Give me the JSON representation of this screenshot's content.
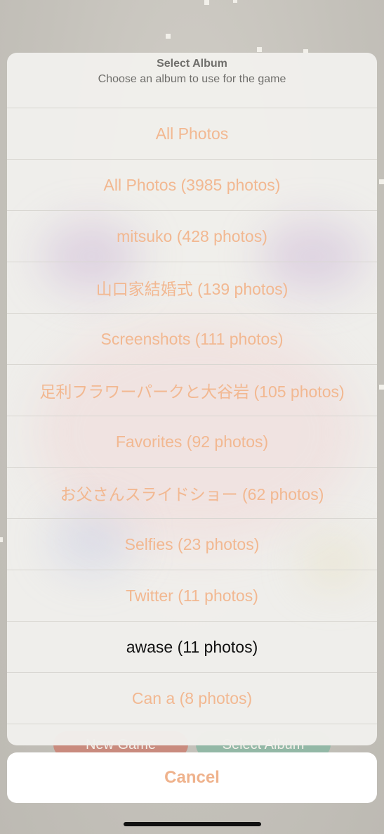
{
  "sheet": {
    "title": "Select Album",
    "subtitle": "Choose an album to use for the game",
    "items": [
      "All Photos",
      "All Photos (3985 photos)",
      "mitsuko (428 photos)",
      "山口家結婚式 (139 photos)",
      "Screenshots (111 photos)",
      "足利フラワーパークと大谷岩 (105 photos)",
      "Favorites (92 photos)",
      "お父さんスライドショー (62 photos)",
      "Selfies (23 photos)",
      "Twitter (11 photos)",
      "awase (11 photos)",
      "Can a (8 photos)"
    ],
    "selected_item": "awase (11 photos)"
  },
  "cancel_label": "Cancel",
  "background": {
    "left_button_label": "New Game",
    "right_button_label": "Select Album"
  },
  "colors": {
    "accent": "#f2b891",
    "cancel": "#efb28c",
    "sheet_bg": "#f1f0ec",
    "backdrop": "#c6c3bc"
  }
}
